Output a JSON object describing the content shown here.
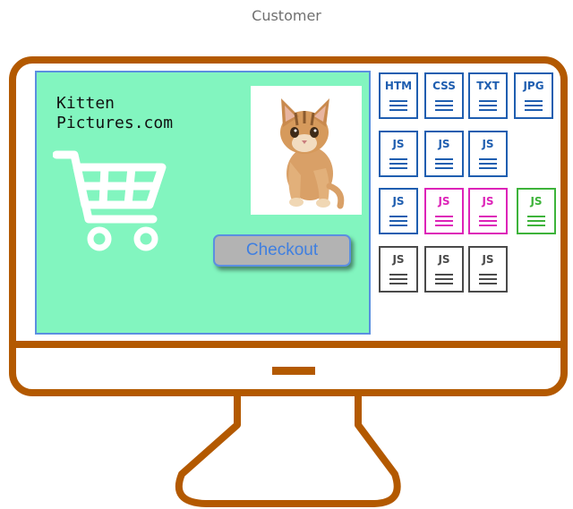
{
  "caption": "Customer",
  "site": {
    "title_line1": "Kitten",
    "title_line2": "Pictures.com"
  },
  "checkout_label": "Checkout",
  "colors": {
    "monitor": "#b35900",
    "screen_bg": "#82f5bf",
    "screen_border": "#5b8fe0",
    "file_blue": "#1f5eb0",
    "file_magenta": "#dd23b8",
    "file_green": "#3db33a",
    "file_gray": "#4a4a4a"
  },
  "files": [
    {
      "label": "HTM",
      "color": "blue"
    },
    {
      "label": "CSS",
      "color": "blue"
    },
    {
      "label": "TXT",
      "color": "blue"
    },
    {
      "label": "JPG",
      "color": "blue"
    },
    {
      "label": "JS",
      "color": "blue"
    },
    {
      "label": "JS",
      "color": "blue"
    },
    {
      "label": "JS",
      "color": "blue"
    },
    {
      "label": "JS",
      "color": "blue"
    },
    {
      "label": "JS",
      "color": "magenta"
    },
    {
      "label": "JS",
      "color": "magenta"
    },
    {
      "label": "JS",
      "color": "green"
    },
    {
      "label": "JS",
      "color": "gray"
    },
    {
      "label": "JS",
      "color": "gray"
    },
    {
      "label": "JS",
      "color": "gray"
    }
  ]
}
